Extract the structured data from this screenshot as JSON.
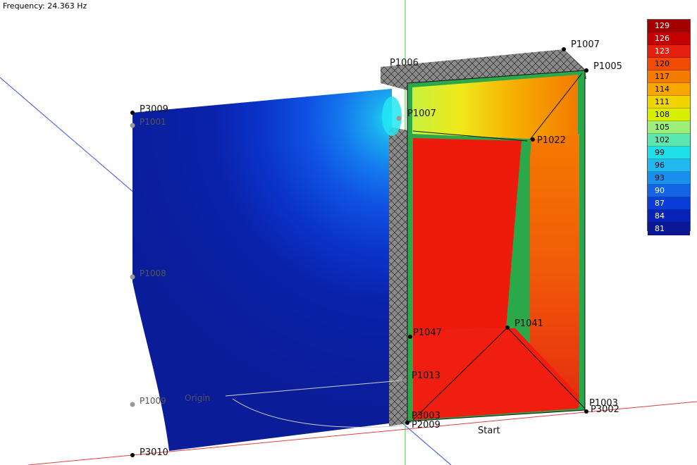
{
  "header": {
    "frequency_label": "Frequency: 24.363 Hz"
  },
  "viewport": {
    "points": [
      {
        "name": "P3009"
      },
      {
        "name": "P1001"
      },
      {
        "name": "P1008"
      },
      {
        "name": "P1009"
      },
      {
        "name": "P3010"
      },
      {
        "name": "P1006"
      },
      {
        "name": "P1007"
      },
      {
        "name": "P1005"
      },
      {
        "name": "P1003"
      },
      {
        "name": "P3002"
      },
      {
        "name": "P1022"
      },
      {
        "name": "P1041"
      },
      {
        "name": "P1047"
      },
      {
        "name": "P1013"
      },
      {
        "name": "P2009"
      },
      {
        "name": "P3003"
      }
    ],
    "origin_label": "Origin",
    "start_label": "Start"
  },
  "legend": {
    "colors": [
      "#a50000",
      "#c40000",
      "#e52010",
      "#f24a00",
      "#f57a00",
      "#f7a700",
      "#f2d400",
      "#d8f000",
      "#9cf07a",
      "#5be8b0",
      "#1fe0e6",
      "#22b8f2",
      "#1a90ee",
      "#1464e6",
      "#0a3cd8",
      "#0822b8",
      "#0a1896"
    ],
    "values": [
      "129",
      "126",
      "123",
      "120",
      "117",
      "114",
      "111",
      "108",
      "105",
      "102",
      "99",
      "96",
      "93",
      "90",
      "87",
      "84",
      "81"
    ]
  }
}
